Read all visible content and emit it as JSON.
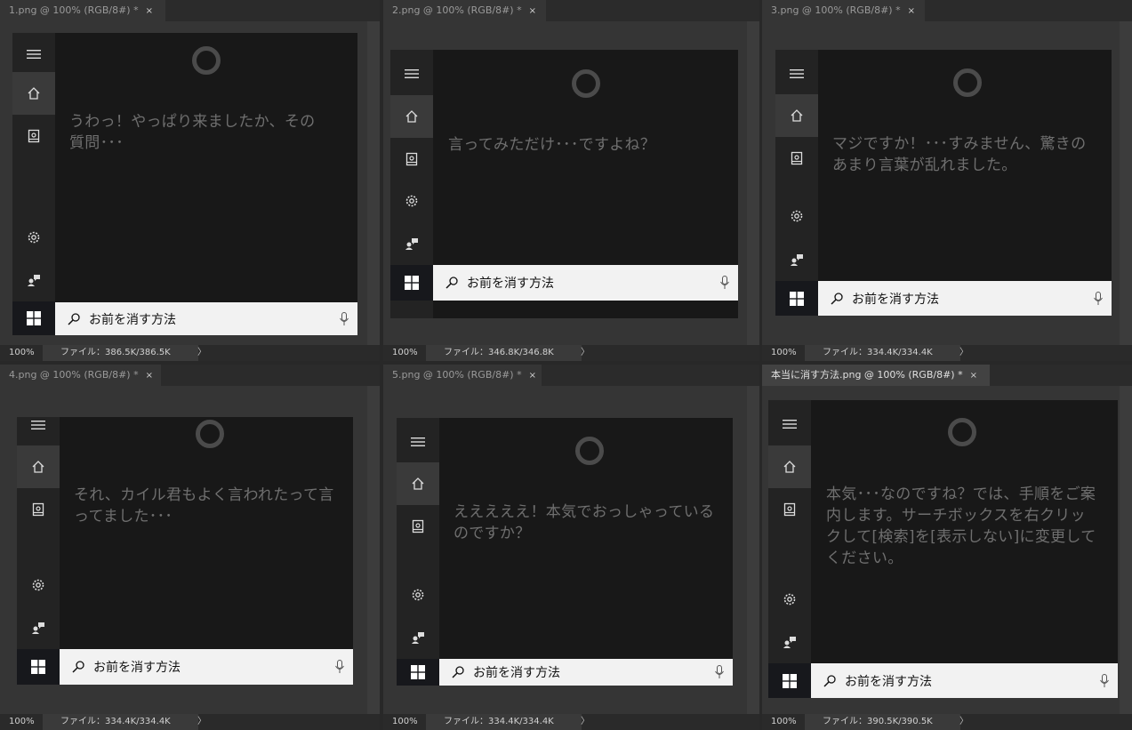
{
  "panes": [
    {
      "tab_label": "1.png @ 100% (RGB/8#) *",
      "zoom": "100%",
      "file_info": "ファイル：386.5K/386.5K",
      "message": "うわっ！やっぱり来ましたか、その質問･･･",
      "search_text": "お前を消す方法"
    },
    {
      "tab_label": "2.png @ 100% (RGB/8#) *",
      "zoom": "100%",
      "file_info": "ファイル：346.8K/346.8K",
      "message": "言ってみただけ･･･ですよね？",
      "search_text": "お前を消す方法"
    },
    {
      "tab_label": "3.png @ 100% (RGB/8#) *",
      "zoom": "100%",
      "file_info": "ファイル：334.4K/334.4K",
      "message": "マジですか！･･･すみません、驚きのあまり言葉が乱れました。",
      "search_text": "お前を消す方法"
    },
    {
      "tab_label": "4.png @ 100% (RGB/8#) *",
      "zoom": "100%",
      "file_info": "ファイル：334.4K/334.4K",
      "message": "それ、カイル君もよく言われたって言ってました･･･",
      "search_text": "お前を消す方法"
    },
    {
      "tab_label": "5.png @ 100% (RGB/8#) *",
      "zoom": "100%",
      "file_info": "ファイル：334.4K/334.4K",
      "message": "えええええ！本気でおっしゃっているのですか？",
      "search_text": "お前を消す方法"
    },
    {
      "tab_label": "本当に消す方法.png @ 100% (RGB/8#) *",
      "zoom": "100%",
      "file_info": "ファイル：390.5K/390.5K",
      "message": "本気･･･なのですね？では、手順をご案内します。サーチボックスを右クリックして[検索]を[表示しない]に変更してください。",
      "search_text": "お前を消す方法"
    }
  ],
  "icons": {
    "tab_close": "×",
    "status_arrow": "〉"
  },
  "colors": {
    "app_bg": "#282828",
    "pane_bg": "#353535",
    "cortana_bg": "#181818",
    "rail_bg": "#232323",
    "search_bg": "#f2f2f2",
    "message_text": "#6f6f6f"
  }
}
